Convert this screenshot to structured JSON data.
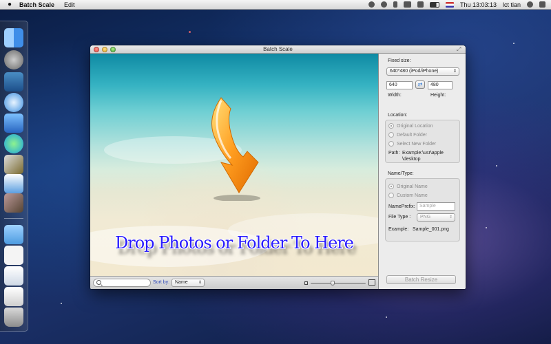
{
  "menubar": {
    "app_name": "Batch Scale",
    "menus": [
      "Edit"
    ],
    "clock": "Thu 13:03:13",
    "user": "lct tian"
  },
  "window": {
    "title": "Batch Scale",
    "drop_text": "Drop Photos or Folder To Here",
    "search_placeholder": "",
    "sort_label": "Sort by:",
    "sort_value": "Name"
  },
  "panel": {
    "fixed_size_label": "Fixed size:",
    "preset_value": "640*480 (iPod/iPhone)",
    "width_value": "640",
    "height_value": "480",
    "width_label": "Width:",
    "height_label": "Height:",
    "location_label": "Location:",
    "location_options": [
      "Original Location",
      "Default Folder",
      "Select New Folder"
    ],
    "path_label": "Path:",
    "path_value_1": "Example:\\usr\\apple",
    "path_value_2": "\\desktop",
    "name_type_label": "Name/Type:",
    "name_options": [
      "Original Name",
      "Custom Name"
    ],
    "name_prefix_label": "NamePrefix:",
    "name_prefix_placeholder": "Sample",
    "file_type_label": "File Type :",
    "file_type_value": "PNG",
    "example_label": "Example:",
    "example_value": "Sample_001.png",
    "batch_button": "Batch Resize"
  },
  "colors": {
    "drop_text": "#2a1cff",
    "sort_label": "#2b45b7"
  }
}
